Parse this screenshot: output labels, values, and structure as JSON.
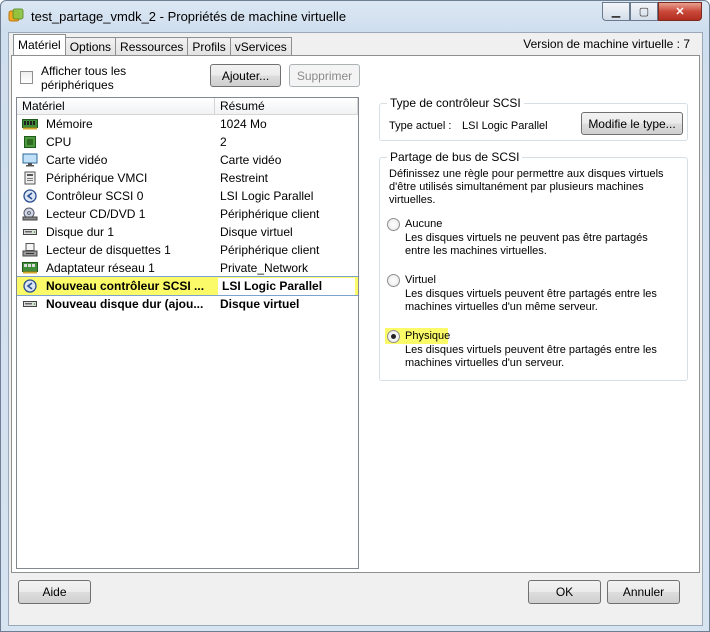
{
  "window": {
    "title": "test_partage_vmdk_2 - Propriétés de machine virtuelle",
    "minimize_glyph": "▁",
    "maximize_glyph": "▢",
    "close_glyph": "✕"
  },
  "tabs": [
    {
      "label": "Matériel",
      "active": true
    },
    {
      "label": "Options"
    },
    {
      "label": "Ressources"
    },
    {
      "label": "Profils"
    },
    {
      "label": "vServices"
    }
  ],
  "vm_version": "Version de machine virtuelle : 7",
  "hardware": {
    "show_all_label": "Afficher tous les périphériques",
    "add_button": "Ajouter...",
    "remove_button": "Supprimer",
    "col_name": "Matériel",
    "col_summary": "Résumé",
    "rows": [
      {
        "icon": "memory-icon",
        "name": "Mémoire",
        "summary": "1024 Mo"
      },
      {
        "icon": "cpu-icon",
        "name": "CPU",
        "summary": "2"
      },
      {
        "icon": "video-card-icon",
        "name": "Carte vidéo",
        "summary": "Carte vidéo"
      },
      {
        "icon": "vmci-device-icon",
        "name": "Périphérique VMCI",
        "summary": "Restreint"
      },
      {
        "icon": "scsi-controller-icon",
        "name": "Contrôleur SCSI 0",
        "summary": "LSI Logic Parallel"
      },
      {
        "icon": "cd-dvd-drive-icon",
        "name": "Lecteur CD/DVD 1",
        "summary": "Périphérique client"
      },
      {
        "icon": "hard-disk-icon",
        "name": "Disque dur 1",
        "summary": "Disque virtuel"
      },
      {
        "icon": "floppy-drive-icon",
        "name": "Lecteur de disquettes 1",
        "summary": "Périphérique client"
      },
      {
        "icon": "network-adapter-icon",
        "name": "Adaptateur réseau 1",
        "summary": "Private_Network"
      },
      {
        "icon": "scsi-controller-icon",
        "name": "Nouveau contrôleur SCSI ...",
        "summary": "LSI Logic Parallel",
        "bold": true,
        "selected": true
      },
      {
        "icon": "hard-disk-icon",
        "name": "Nouveau disque dur (ajou...",
        "summary": "Disque virtuel",
        "bold": true
      }
    ]
  },
  "scsi_type": {
    "group_title": "Type de contrôleur SCSI",
    "current_label": "Type actuel :",
    "current_value": "LSI Logic Parallel",
    "change_button": "Modifie le type..."
  },
  "bus_sharing": {
    "group_title": "Partage de bus de SCSI",
    "description": "Définissez une règle pour permettre aux disques virtuels d'être utilisés simultanément par plusieurs machines virtuelles.",
    "options": [
      {
        "label": "Aucune",
        "description": "Les disques virtuels ne peuvent pas être partagés entre les machines virtuelles.",
        "selected": false
      },
      {
        "label": "Virtuel",
        "description": "Les disques virtuels peuvent être partagés entre les machines virtuelles d'un même serveur.",
        "selected": false
      },
      {
        "label": "Physique",
        "description": "Les disques virtuels peuvent être partagés entre les machines virtuelles d'un serveur.",
        "selected": true
      }
    ]
  },
  "footer": {
    "help_button": "Aide",
    "ok_button": "OK",
    "cancel_button": "Annuler"
  },
  "colors": {
    "highlight": "#fbfb6a",
    "title_bar": "#d6e3f1",
    "close_button": "#c9483a"
  }
}
